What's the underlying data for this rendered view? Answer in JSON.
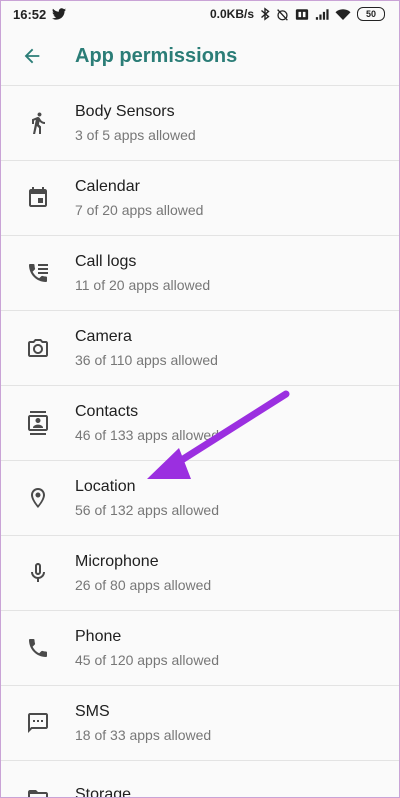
{
  "status_bar": {
    "time": "16:52",
    "net_speed": "0.0KB/s",
    "battery": "50"
  },
  "app_bar": {
    "title": "App permissions"
  },
  "permissions": [
    {
      "label": "Body Sensors",
      "summary": "3 of 5 apps allowed",
      "icon": "body-sensors-icon"
    },
    {
      "label": "Calendar",
      "summary": "7 of 20 apps allowed",
      "icon": "calendar-icon"
    },
    {
      "label": "Call logs",
      "summary": "11 of 20 apps allowed",
      "icon": "call-logs-icon"
    },
    {
      "label": "Camera",
      "summary": "36 of 110 apps allowed",
      "icon": "camera-icon"
    },
    {
      "label": "Contacts",
      "summary": "46 of 133 apps allowed",
      "icon": "contacts-icon"
    },
    {
      "label": "Location",
      "summary": "56 of 132 apps allowed",
      "icon": "location-icon"
    },
    {
      "label": "Microphone",
      "summary": "26 of 80 apps allowed",
      "icon": "microphone-icon"
    },
    {
      "label": "Phone",
      "summary": "45 of 120 apps allowed",
      "icon": "phone-icon"
    },
    {
      "label": "SMS",
      "summary": "18 of 33 apps allowed",
      "icon": "sms-icon"
    },
    {
      "label": "Storage",
      "summary": "",
      "icon": "storage-icon"
    }
  ],
  "colors": {
    "accent": "#2b7d77",
    "annotation_arrow": "#9b2fe0"
  }
}
